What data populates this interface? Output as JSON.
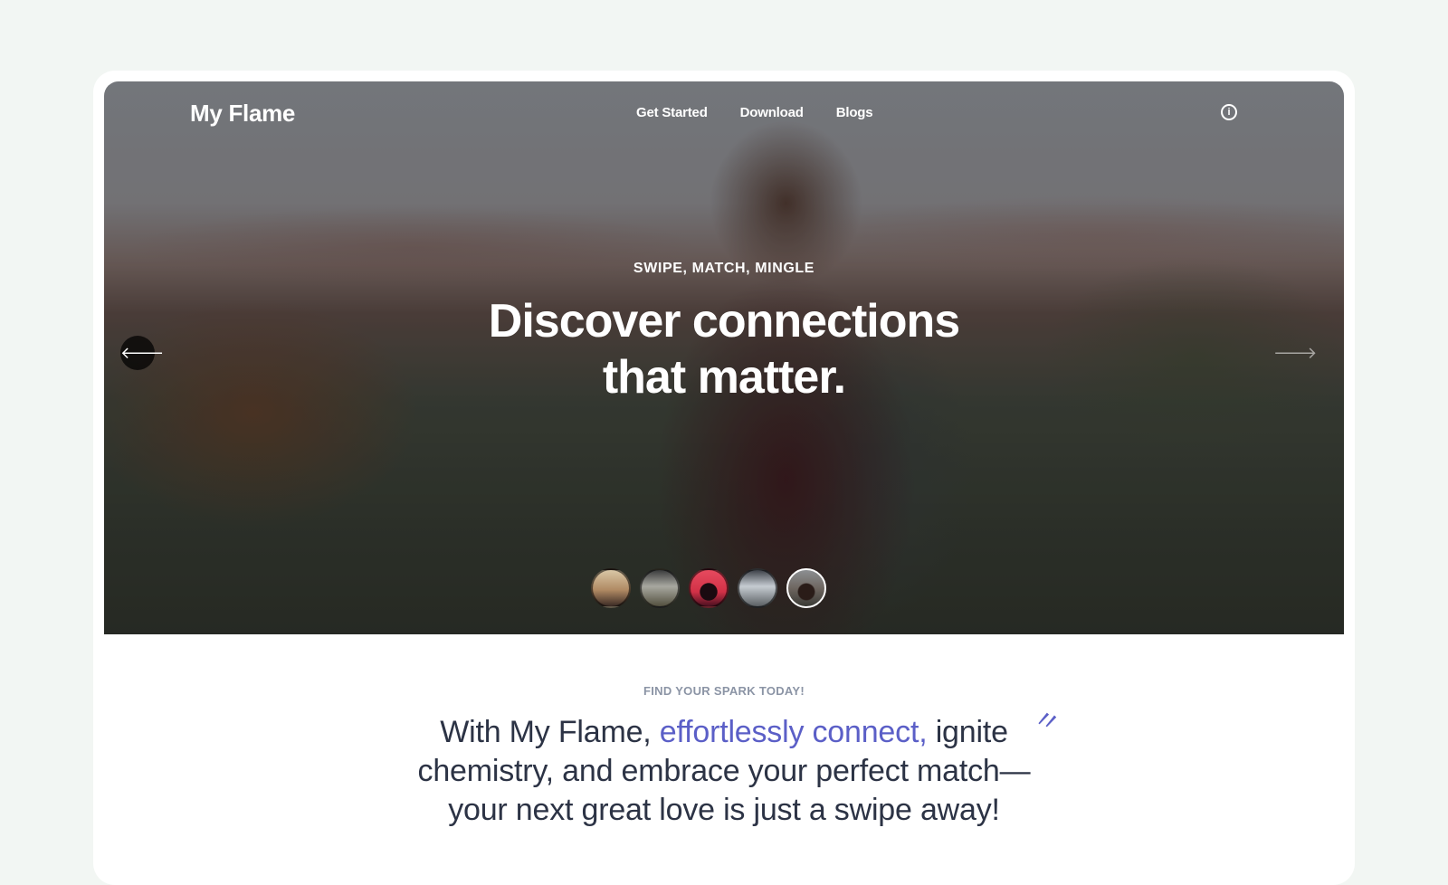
{
  "brand": {
    "name": "My Flame"
  },
  "nav": {
    "items": [
      {
        "label": "Get Started"
      },
      {
        "label": "Download"
      },
      {
        "label": "Blogs"
      }
    ]
  },
  "hero": {
    "eyebrow": "SWIPE, MATCH, MINGLE",
    "headline_line1": "Discover connections",
    "headline_line2": "that matter.",
    "prev_arrow": "🡐",
    "next_arrow": "🡒",
    "thumbnails_count": 5,
    "active_thumbnail": 5
  },
  "section": {
    "kicker": "FIND YOUR SPARK TODAY!",
    "lead_prefix": "With My Flame, ",
    "lead_accent": "effortlessly connect,",
    "lead_suffix": " ignite chemistry, and embrace your perfect match—your next great love is just a swipe away!"
  },
  "colors": {
    "accent": "#5b5fc7",
    "page_bg": "#f2f6f3",
    "text_dark": "#2c3345",
    "muted": "#8b94a5"
  },
  "icons": {
    "info": "info-icon",
    "prev": "arrow-left-icon",
    "next": "arrow-right-icon"
  }
}
